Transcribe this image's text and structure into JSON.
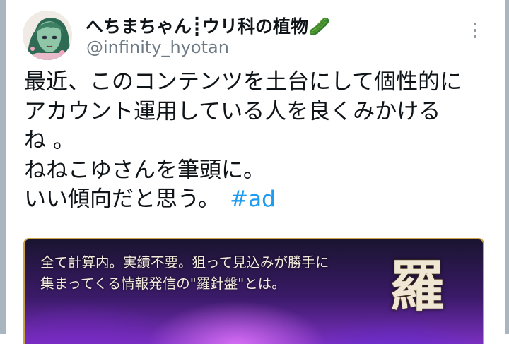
{
  "tweet": {
    "display_name": "へちまちゃん┋ウリ科の植物🥒",
    "handle": "@infinity_hyotan",
    "more_icon": "more-vertical-icon",
    "body_lines": [
      "最近、このコンテンツを土台にして個性的に",
      "アカウント運用している人を良くみかける",
      "ね 。",
      "ねねこゆさんを筆頭に。",
      "いい傾向だと思う。"
    ],
    "hashtag": "#ad",
    "hashtag_color": "#1d9bf0"
  },
  "ad_card": {
    "lines": [
      "全て計算内。実績不要。狙って見込みが勝手に",
      "集まってくる情報発信の\"羅針盤\"とは。"
    ],
    "title_kanji": "羅",
    "border_color": "#c9a24a"
  }
}
